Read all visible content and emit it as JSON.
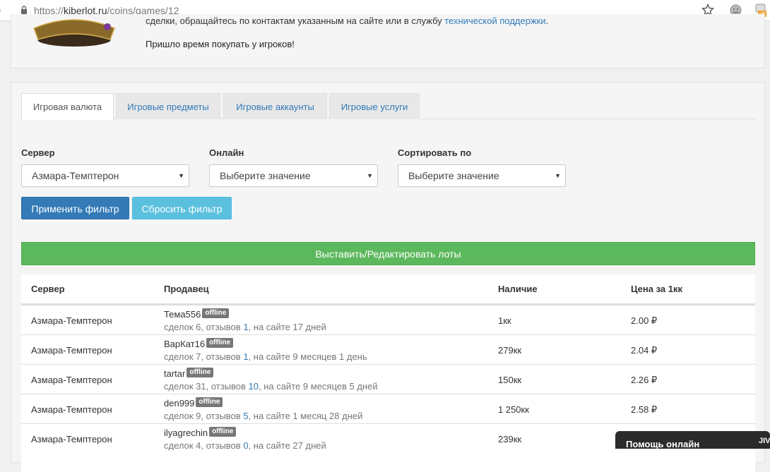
{
  "browser": {
    "url_scheme": "https://",
    "url_host": "kiberlot.ru",
    "url_path": "/coins/games/12",
    "ext_badge": "off"
  },
  "top_panel": {
    "notice_text": "сделки, обращайтесь по контактам указанным на сайте или в службу ",
    "notice_link": "технической поддержки",
    "notice_end": ".",
    "promo": "Пришло время покупать у игроков!"
  },
  "tabs": [
    {
      "label": "Игровая валюта",
      "active": true
    },
    {
      "label": "Игровые предметы",
      "active": false
    },
    {
      "label": "Игровые аккаунты",
      "active": false
    },
    {
      "label": "Игровые услуги",
      "active": false
    }
  ],
  "filters": {
    "server_label": "Сервер",
    "server_value": "Азмара-Темптерон",
    "online_label": "Онлайн",
    "online_value": "Выберите значение",
    "sort_label": "Сортировать по",
    "sort_value": "Выберите значение",
    "apply": "Применить фильтр",
    "reset": "Сбросить фильтр"
  },
  "lots_button": "Выставить/Редактировать лоты",
  "table": {
    "headers": {
      "server": "Сервер",
      "seller": "Продавец",
      "stock": "Наличие",
      "price": "Цена за 1кк"
    },
    "rows": [
      {
        "server": "Азмара-Темптерон",
        "seller": "Тема556",
        "status": "offline",
        "deals": "сделок 6, отзывов ",
        "reviews": "1",
        "since": ", на сайте 17 дней",
        "stock": "1кк",
        "price": "2.00 ₽"
      },
      {
        "server": "Азмара-Темптерон",
        "seller": "ВарКат16",
        "status": "offline",
        "deals": "сделок 7, отзывов ",
        "reviews": "1",
        "since": ", на сайте 9 месяцев 1 день",
        "stock": "279кк",
        "price": "2.04 ₽"
      },
      {
        "server": "Азмара-Темптерон",
        "seller": "tartar",
        "status": "offline",
        "deals": "сделок 31, отзывов ",
        "reviews": "10",
        "since": ", на сайте 9 месяцев 5 дней",
        "stock": "150кк",
        "price": "2.26 ₽"
      },
      {
        "server": "Азмара-Темптерон",
        "seller": "den999",
        "status": "offline",
        "deals": "сделок 9, отзывов ",
        "reviews": "5",
        "since": ", на сайте 1 месяц 28 дней",
        "stock": "1 250кк",
        "price": "2.58 ₽"
      },
      {
        "server": "Азмара-Темптерон",
        "seller": "ilyagrechin",
        "status": "offline",
        "deals": "сделок 4, отзывов ",
        "reviews": "0",
        "since": ", на сайте 27 дней",
        "stock": "239кк",
        "price": ""
      }
    ]
  },
  "help_widget": {
    "label": "Помощь онлайн",
    "brand": "JIVO"
  },
  "colors": {
    "primary": "#337ab7",
    "info": "#5bc0de",
    "success": "#5cb85c",
    "badge": "#777777"
  }
}
